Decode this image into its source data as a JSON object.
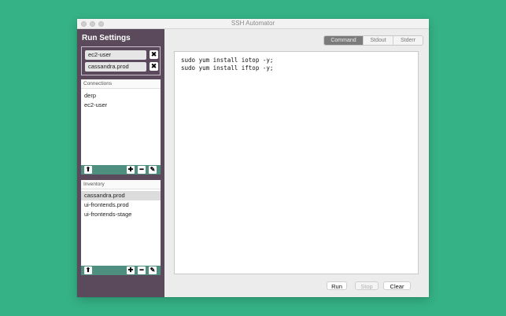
{
  "window": {
    "title": "SSH Automator"
  },
  "sidebar": {
    "title": "Run Settings",
    "selected_targets": [
      "ec2-user",
      "cassandra.prod"
    ],
    "remove_glyph": "✖",
    "connections": {
      "label": "Connections",
      "items": [
        "derp",
        "ec2-user"
      ],
      "selected": null
    },
    "inventory": {
      "label": "Inventory",
      "items": [
        "cassandra.prod",
        "ui-frontends.prod",
        "ui-frontends-stage"
      ],
      "selected": 0
    },
    "toolbar_icons": {
      "up": "⬆",
      "add": "✚",
      "remove": "━",
      "edit": "✎"
    }
  },
  "main": {
    "tabs": [
      {
        "label": "Command",
        "active": true
      },
      {
        "label": "Stdout",
        "active": false
      },
      {
        "label": "Stderr",
        "active": false
      }
    ],
    "command_lines": [
      "sudo yum install iotop -y;",
      "sudo yum install iftop -y;"
    ],
    "buttons": {
      "run": "Run",
      "stop": "Stop",
      "clear": "Clear"
    }
  },
  "colors": {
    "desktop": "#35b286",
    "sidebar": "#5b4a5b",
    "toolbar": "#4f8f7f"
  }
}
